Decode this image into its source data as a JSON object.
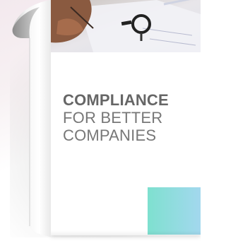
{
  "cover": {
    "headline_bold": "COMPLIANCE",
    "headline_line2": "FOR BETTER",
    "headline_line3": "COMPANIES"
  },
  "colors": {
    "headline": "#666666",
    "accent_start": "#7ee0cf",
    "accent_end": "#a3d8ee"
  },
  "images": {
    "cover_photo": "hands-with-magnifying-glass-over-documents"
  }
}
